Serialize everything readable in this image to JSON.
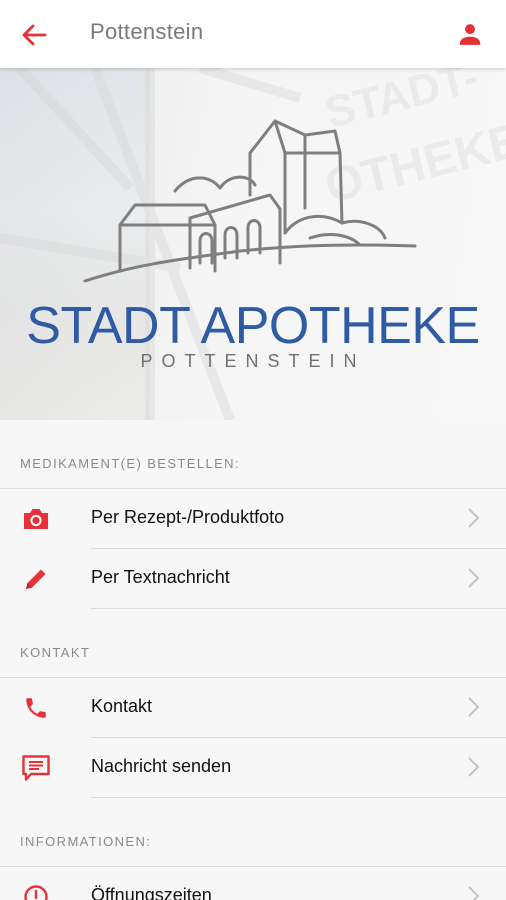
{
  "appbar": {
    "title": "Pottenstein",
    "icons": {
      "back": "back-arrow-icon",
      "user": "user-icon"
    }
  },
  "hero": {
    "brand_name": "STADT APOTHEKE",
    "brand_sub": "POTTENSTEIN",
    "colors": {
      "brand": "#2f5aa5"
    }
  },
  "sections": [
    {
      "header": "MEDIKAMENT(E) BESTELLEN:",
      "items": [
        {
          "label": "Per Rezept-/Produktfoto",
          "icon": "camera-icon"
        },
        {
          "label": "Per Textnachricht",
          "icon": "pencil-icon"
        }
      ]
    },
    {
      "header": "KONTAKT",
      "items": [
        {
          "label": "Kontakt",
          "icon": "phone-icon"
        },
        {
          "label": "Nachricht senden",
          "icon": "message-icon"
        }
      ]
    },
    {
      "header": "INFORMATIONEN:",
      "items": [
        {
          "label": "Öffnungszeiten",
          "icon": "clock-icon"
        }
      ]
    }
  ],
  "theme": {
    "accent": "#e53238"
  }
}
